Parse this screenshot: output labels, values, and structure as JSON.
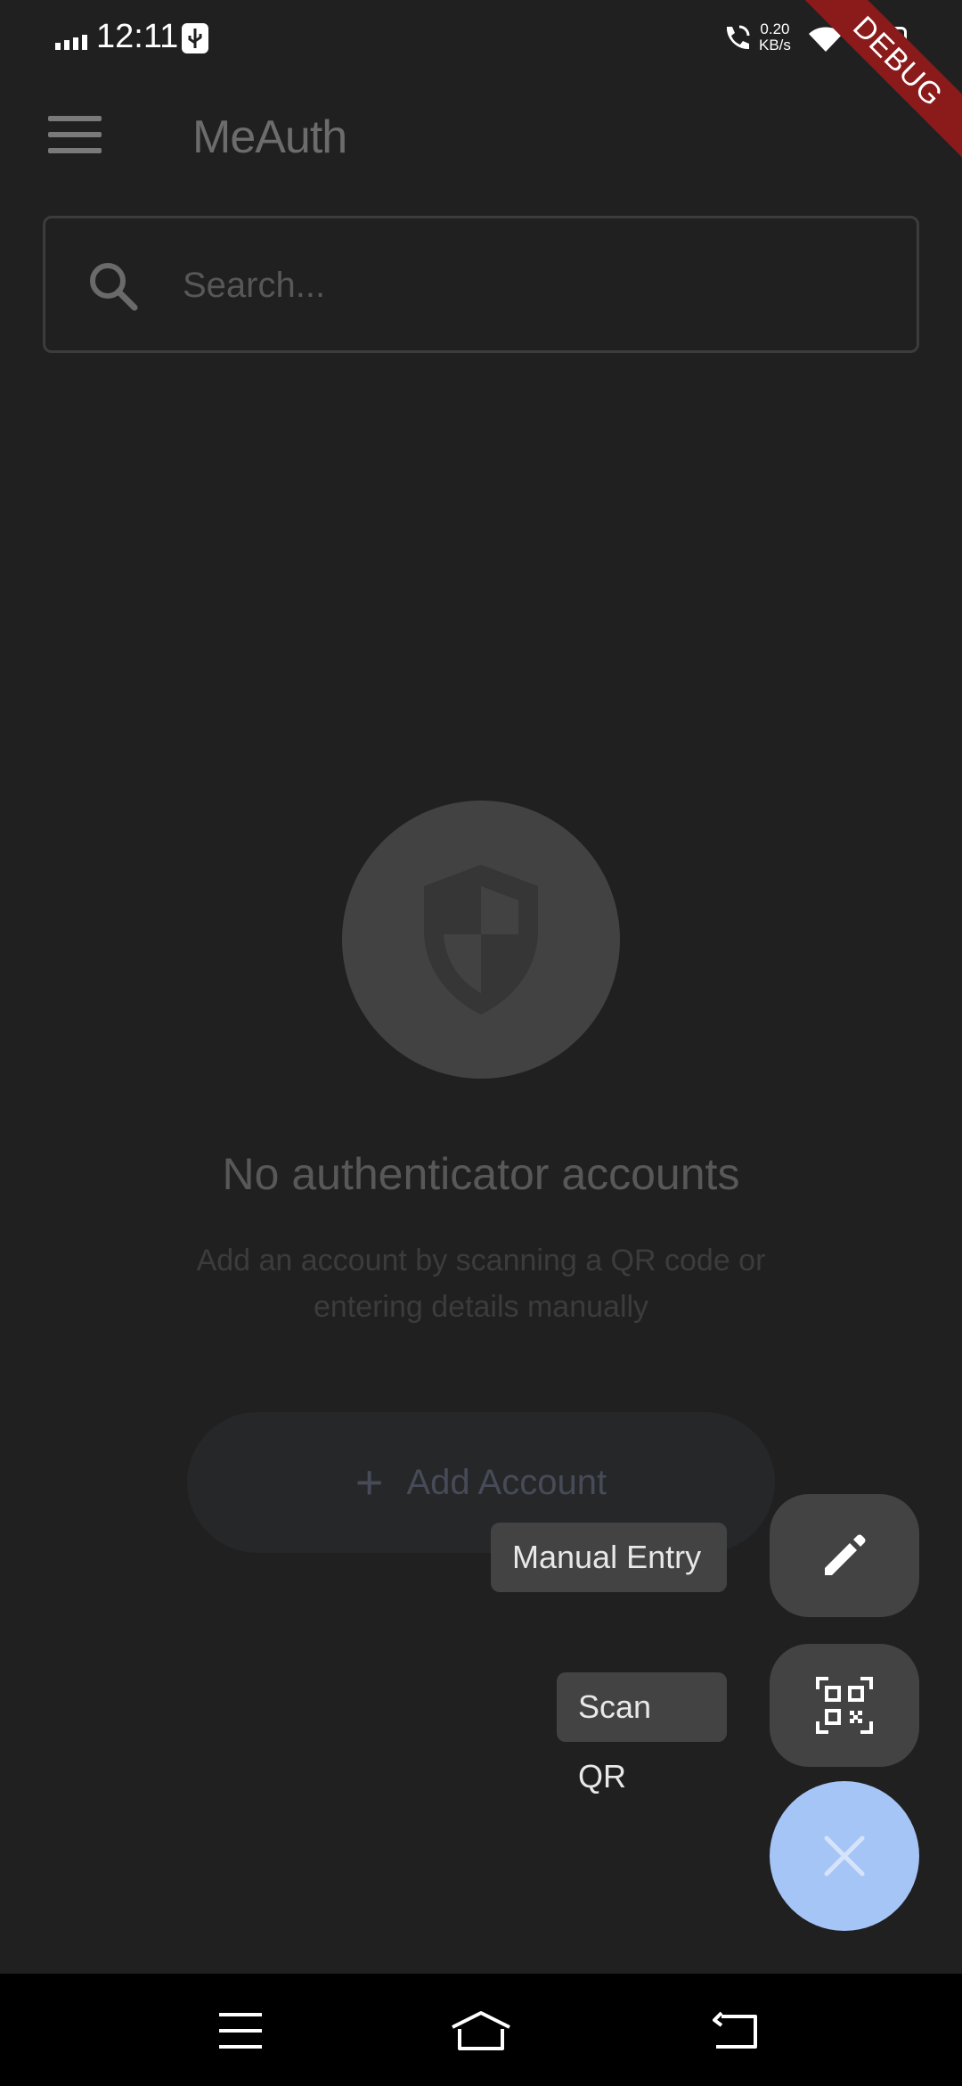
{
  "status_bar": {
    "time": "12:11",
    "net_speed_value": "0.20",
    "net_speed_unit": "KB/s",
    "icons": [
      "signal-icon",
      "usb-icon",
      "call-icon",
      "wifi-icon",
      "battery-icon"
    ]
  },
  "debug_banner": "DEBUG",
  "app_bar": {
    "title": "MeAuth",
    "menu_icon": "menu-icon"
  },
  "search": {
    "placeholder": "Search...",
    "value": "",
    "icon": "search-icon"
  },
  "empty_state": {
    "icon": "shield-icon",
    "title": "No authenticator accounts",
    "description": "Add an account by scanning a QR code or entering details manually",
    "add_button": {
      "icon": "plus-icon",
      "label": "Add Account"
    }
  },
  "speed_dial": {
    "actions": [
      {
        "label": "Manual Entry",
        "icon": "pencil-icon"
      },
      {
        "label": "Scan QR",
        "icon": "qr-scan-icon"
      }
    ],
    "close_icon": "close-icon"
  },
  "colors": {
    "background": "#202020",
    "surface": "#434343",
    "fab_accent": "#a6c5f7",
    "debug_banner": "#8b1a1a"
  },
  "nav_bar": {
    "icons": [
      "recents-icon",
      "home-icon",
      "back-icon"
    ]
  }
}
